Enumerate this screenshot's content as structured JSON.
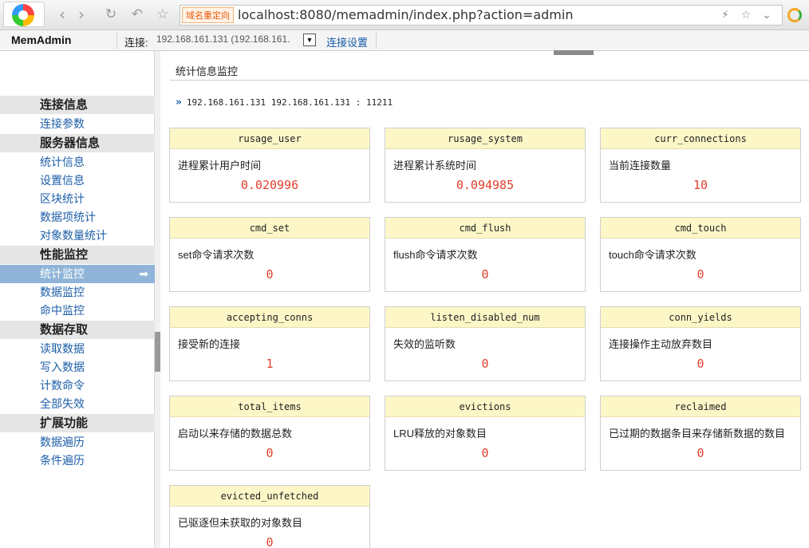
{
  "browser": {
    "redirect_badge": "域名重定向",
    "url": "localhost:8080/memadmin/index.php?action=admin",
    "icons": [
      "app-logo-icon",
      "back-icon",
      "forward-icon",
      "reload-icon",
      "undo-icon",
      "star-icon",
      "lightning-icon",
      "bookmark-star-icon",
      "dropdown-icon",
      "extension-icon"
    ]
  },
  "topbar": {
    "app_title": "MemAdmin",
    "conn_label": "连接:",
    "conn_value": "192.168.161.131 (192.168.161.",
    "conn_settings": "连接设置"
  },
  "sidebar": {
    "groups": [
      {
        "label": "连接信息",
        "items": [
          {
            "label": "连接参数"
          }
        ]
      },
      {
        "label": "服务器信息",
        "items": [
          {
            "label": "统计信息"
          },
          {
            "label": "设置信息"
          },
          {
            "label": "区块统计"
          },
          {
            "label": "数据项统计"
          },
          {
            "label": "对象数量统计"
          }
        ]
      },
      {
        "label": "性能监控",
        "items": [
          {
            "label": "统计监控",
            "active": true
          },
          {
            "label": "数据监控"
          },
          {
            "label": "命中监控"
          }
        ]
      },
      {
        "label": "数据存取",
        "items": [
          {
            "label": "读取数据"
          },
          {
            "label": "写入数据"
          },
          {
            "label": "计数命令"
          },
          {
            "label": "全部失效"
          }
        ]
      },
      {
        "label": "扩展功能",
        "items": [
          {
            "label": "数据遍历"
          },
          {
            "label": "条件遍历"
          }
        ]
      }
    ]
  },
  "main": {
    "title": "统计信息监控",
    "server_line": "192.168.161.131 192.168.161.131 : 11211",
    "cards": [
      {
        "key": "rusage_user",
        "desc": "进程累计用户时间",
        "value": "0.020996"
      },
      {
        "key": "rusage_system",
        "desc": "进程累计系统时间",
        "value": "0.094985"
      },
      {
        "key": "curr_connections",
        "desc": "当前连接数量",
        "value": "10"
      },
      {
        "key": "cmd_set",
        "desc": "set命令请求次数",
        "value": "0"
      },
      {
        "key": "cmd_flush",
        "desc": "flush命令请求次数",
        "value": "0"
      },
      {
        "key": "cmd_touch",
        "desc": "touch命令请求次数",
        "value": "0"
      },
      {
        "key": "accepting_conns",
        "desc": "接受新的连接",
        "value": "1"
      },
      {
        "key": "listen_disabled_num",
        "desc": "失效的监听数",
        "value": "0"
      },
      {
        "key": "conn_yields",
        "desc": "连接操作主动放弃数目",
        "value": "0"
      },
      {
        "key": "total_items",
        "desc": "启动以来存储的数据总数",
        "value": "0"
      },
      {
        "key": "evictions",
        "desc": "LRU释放的对象数目",
        "value": "0"
      },
      {
        "key": "reclaimed",
        "desc": "已过期的数据条目来存储新数据的数目",
        "value": "0"
      },
      {
        "key": "evicted_unfetched",
        "desc": "已驱逐但未获取的对象数目",
        "value": "0"
      }
    ]
  }
}
